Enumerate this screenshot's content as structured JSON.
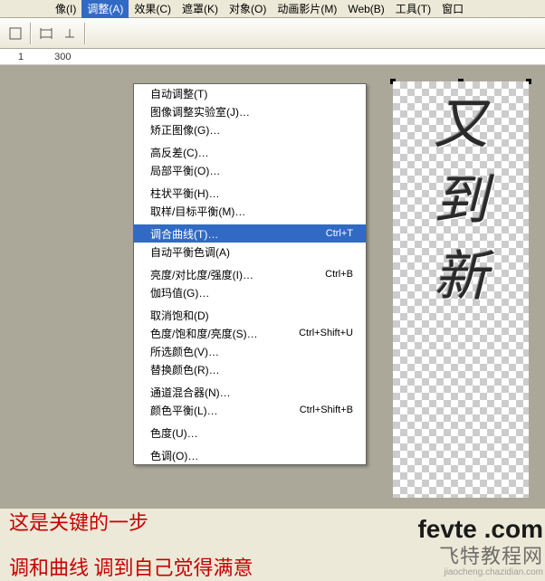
{
  "menubar": {
    "items": [
      "像(I)",
      "调整(A)",
      "效果(C)",
      "遮罩(K)",
      "对象(O)",
      "动画影片(M)",
      "Web(B)",
      "工具(T)",
      "窗口"
    ]
  },
  "ruler": {
    "v1": "1",
    "v2": "300"
  },
  "dropdown": {
    "sections": [
      [
        {
          "label": "自动调整(T)",
          "short": ""
        },
        {
          "label": "图像调整实验室(J)…",
          "short": ""
        },
        {
          "label": "矫正图像(G)…",
          "short": ""
        }
      ],
      [
        {
          "label": "高反差(C)…",
          "short": ""
        },
        {
          "label": "局部平衡(O)…",
          "short": ""
        }
      ],
      [
        {
          "label": "柱状平衡(H)…",
          "short": ""
        },
        {
          "label": "取样/目标平衡(M)…",
          "short": ""
        }
      ],
      [
        {
          "label": "调合曲线(T)…",
          "short": "Ctrl+T",
          "sel": true
        },
        {
          "label": "自动平衡色调(A)",
          "short": ""
        }
      ],
      [
        {
          "label": "亮度/对比度/强度(I)…",
          "short": "Ctrl+B"
        },
        {
          "label": "伽玛值(G)…",
          "short": ""
        }
      ],
      [
        {
          "label": "取消饱和(D)",
          "short": ""
        },
        {
          "label": "色度/饱和度/亮度(S)…",
          "short": "Ctrl+Shift+U"
        },
        {
          "label": "所选颜色(V)…",
          "short": ""
        },
        {
          "label": "替换颜色(R)…",
          "short": ""
        }
      ],
      [
        {
          "label": "通道混合器(N)…",
          "short": ""
        },
        {
          "label": "颜色平衡(L)…",
          "short": "Ctrl+Shift+B"
        }
      ],
      [
        {
          "label": "色度(U)…",
          "short": ""
        }
      ],
      [
        {
          "label": "色调(O)…",
          "short": ""
        }
      ]
    ]
  },
  "calligraphy": [
    "又",
    "到",
    "新"
  ],
  "captions": {
    "line1": "这是关键的一步",
    "line2": "调和曲线 调到自己觉得满意"
  },
  "watermark": {
    "brand1": "fevte",
    "brand2": ".com",
    "cn": "飞特教程网",
    "url": "jiaocheng.chazidian.com"
  }
}
